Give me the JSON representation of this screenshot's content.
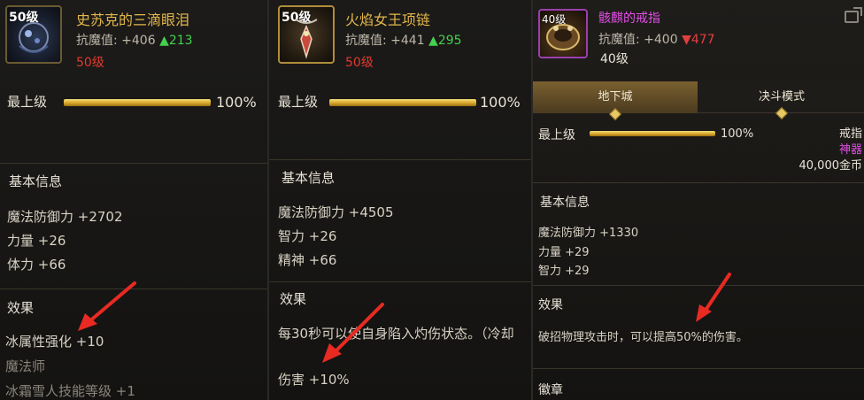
{
  "panels": [
    {
      "level_tag": "50级",
      "item_name": "史苏克的三滴眼泪",
      "resist_label": "抗魔值:",
      "resist_base": "+406",
      "resist_change_arrow": "▲",
      "resist_change": "213",
      "req_level": "50级",
      "grade_label": "最上级",
      "grade_percent": "100%",
      "grade_fill": 1.0,
      "basic_title": "基本信息",
      "basic_attrs": [
        "魔法防御力 +2702",
        "力量 +26",
        "体力 +66"
      ],
      "effect_title": "效果",
      "effects": [
        "冰属性强化 +10",
        "魔法师",
        "冰霜雪人技能等级 +1"
      ]
    },
    {
      "level_tag": "50级",
      "item_name": "火焰女王项链",
      "resist_label": "抗魔值:",
      "resist_base": "+441",
      "resist_change_arrow": "▲",
      "resist_change": "295",
      "req_level": "50级",
      "grade_label": "最上级",
      "grade_percent": "100%",
      "grade_fill": 1.0,
      "basic_title": "基本信息",
      "basic_attrs": [
        "魔法防御力 +4505",
        "智力 +26",
        "精神 +66"
      ],
      "effect_title": "效果",
      "effects": [
        "每30秒可以使自身陷入灼伤状态。（冷却",
        "伤害 +10%"
      ]
    },
    {
      "level_tag": "40级",
      "item_name": "骸麒的戒指",
      "resist_label": "抗魔值:",
      "resist_base": "+400",
      "resist_change_arrow": "▼",
      "resist_change": "477",
      "req_level": "40级",
      "tabs": [
        "地下城",
        "决斗模式"
      ],
      "grade_label": "最上级",
      "grade_percent": "100%",
      "grade_fill": 1.0,
      "item_type": "戒指",
      "item_rarity": "神器",
      "price": "40,000金币",
      "basic_title": "基本信息",
      "basic_attrs": [
        "魔法防御力 +1330",
        "力量 +29",
        "智力 +29"
      ],
      "effect_title": "效果",
      "effects": [
        "破招物理攻击时，可以提高50%的伤害。"
      ],
      "emblem_title": "徽章"
    }
  ],
  "colors": {
    "gold_name": "#e3b64a",
    "artifact_name": "#e24ee6",
    "up": "#45d04d",
    "down": "#e04040",
    "arrow_red": "#e82a22"
  },
  "icons": [
    "crystal-tears-item-icon",
    "flame-necklace-item-icon",
    "skull-ring-item-icon",
    "share-icon",
    "red-arrow-annotation"
  ]
}
